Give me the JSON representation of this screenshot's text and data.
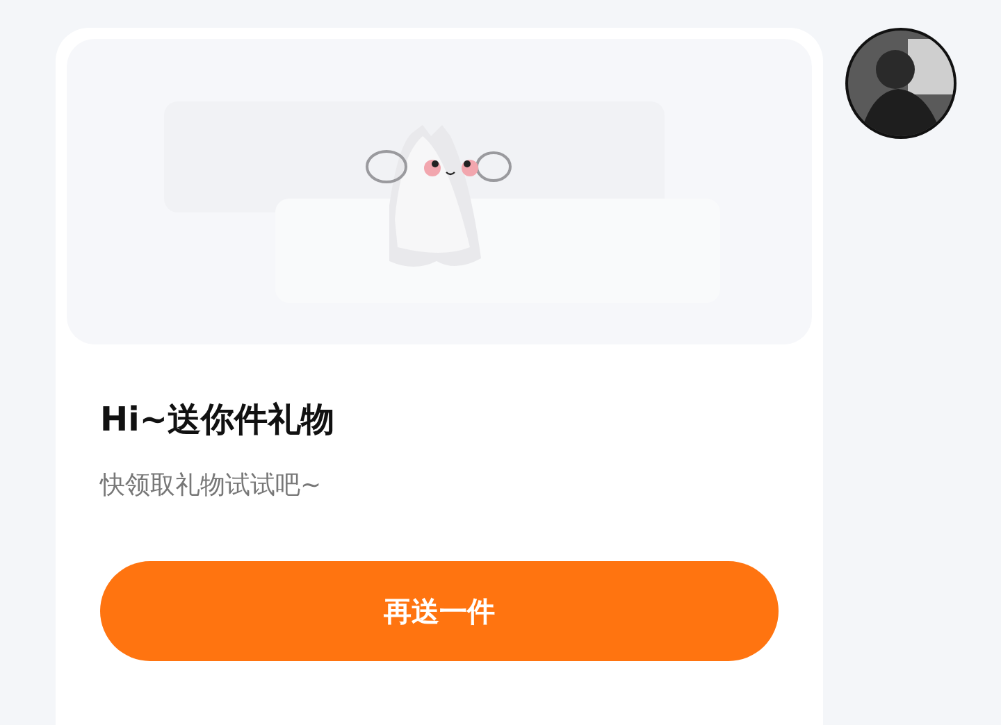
{
  "card": {
    "title": "Hi~送你件礼物",
    "subtitle": "快领取礼物试试吧~",
    "button": "再送一件"
  }
}
